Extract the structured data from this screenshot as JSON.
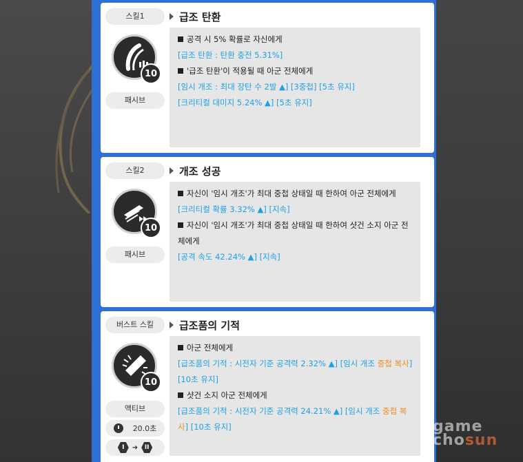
{
  "skills": [
    {
      "type_label": "스킬1",
      "name": "급조 탄환",
      "level": "10",
      "mode_label": "패시브",
      "lines": [
        {
          "kind": "header",
          "text": "공격 시 5% 확률로 자신에게"
        },
        {
          "kind": "blue",
          "text": "[급조 탄환 : 탄환 충전 5.31%]"
        },
        {
          "kind": "header",
          "text": "'급조 탄환'이 적용될 때 아군 전체에게"
        },
        {
          "kind": "blue",
          "text": "[임시 개조 : 최대 장탄 수 2발 ▲] [3중첩] [5초 유지]"
        },
        {
          "kind": "blue",
          "text": "[크리티컬 대미지 5.24% ▲] [5초 유지]"
        }
      ]
    },
    {
      "type_label": "스킬2",
      "name": "개조 성공",
      "level": "10",
      "mode_label": "패시브",
      "lines": [
        {
          "kind": "header",
          "text": "자신이 '임시 개조'가 최대 중첩 상태일 때 한하여 아군 전체에게"
        },
        {
          "kind": "blue",
          "text": "[크리티컬 확률 3.32% ▲] [지속]"
        },
        {
          "kind": "header",
          "text": "자신이 '임시 개조'가 최대 중첩 상태일 때 한하여 샷건 소지 아군 전체에게"
        },
        {
          "kind": "blue",
          "text": "[공격 속도 42.24% ▲] [지속]"
        }
      ]
    },
    {
      "type_label": "버스트 스킬",
      "name": "급조품의 기적",
      "level": "10",
      "mode_label": "액티브",
      "cooldown": "20.0초",
      "burst_from": "I",
      "burst_to": "II",
      "lines": [
        {
          "kind": "header",
          "text": "아군 전체에게"
        },
        {
          "kind": "mixed",
          "parts": [
            {
              "c": "blue",
              "t": "[급조품의 기적 : 시전자 기준 공격력 2.32% ▲] [임시 개조 "
            },
            {
              "c": "orange",
              "t": "중첩 복사"
            },
            {
              "c": "blue",
              "t": "] [10초 유지]"
            }
          ]
        },
        {
          "kind": "header",
          "text": "샷건 소지 아군 전체에게"
        },
        {
          "kind": "mixed",
          "parts": [
            {
              "c": "blue",
              "t": "[급조품의 기적 : 시전자 기준 공격력 24.21% ▲] [임시 개조 "
            },
            {
              "c": "orange",
              "t": "중첩 복사"
            },
            {
              "c": "blue",
              "t": "] [10초 유지]"
            }
          ]
        }
      ]
    }
  ],
  "watermark": {
    "line1": "game",
    "line2a": "cho",
    "line2b": "sun"
  }
}
